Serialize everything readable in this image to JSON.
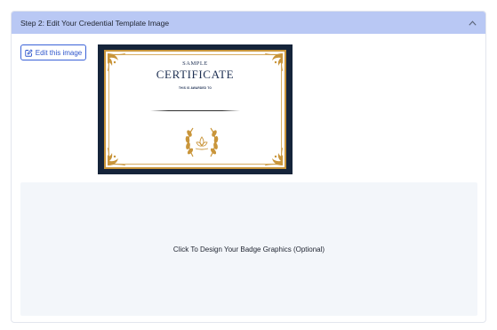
{
  "step_panel": {
    "title": "Step 2: Edit Your Credential Template Image",
    "collapse_icon": "chevron-up-icon"
  },
  "edit_button": {
    "label": "Edit this image",
    "icon": "edit-icon"
  },
  "certificate": {
    "sample_text": "SAMPLE",
    "title_text": "CERTIFICATE",
    "awarded_text": "THIS IS AWARDED TO",
    "frame_color": "#15243a",
    "gold_color": "#c9953a"
  },
  "badge_area": {
    "label": "Click To Design Your Badge Graphics (Optional)"
  },
  "colors": {
    "header_bg": "#b9c8f4",
    "accent": "#2f56cc",
    "badge_area_bg": "#f3f6fa"
  }
}
